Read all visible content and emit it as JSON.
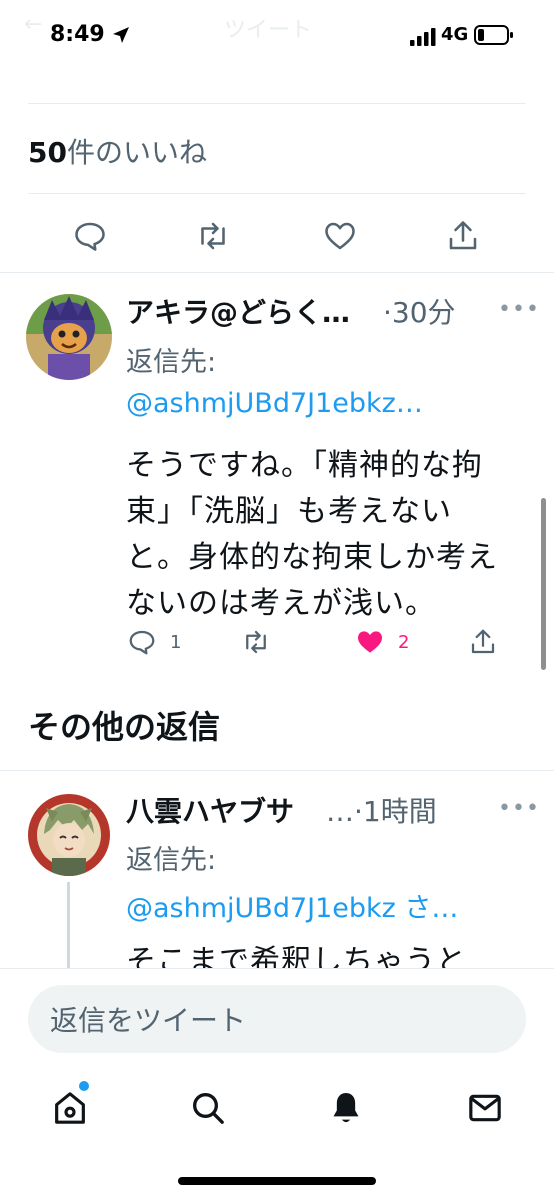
{
  "status_bar": {
    "time": "8:49",
    "network": "4G"
  },
  "header": {
    "ghost_title": "ツイート"
  },
  "likes": {
    "count": "50",
    "label": "件のいいね"
  },
  "reply1": {
    "name": "アキラ@どらく…",
    "time": "·30分",
    "more": "•••",
    "reply_to_label": "返信先:",
    "mention": "@ashmjUBd7J1ebkz…",
    "body": [
      "そうですね。「精神的な拘",
      "束」「洗脳」も考えない",
      "と。身体的な拘束しか考え",
      "ないのは考えが浅い。"
    ],
    "reply_count": "1",
    "like_count": "2"
  },
  "section": {
    "other_replies": "その他の返信"
  },
  "reply2": {
    "name": "八雲ハヤブサ",
    "time": "…·1時間",
    "more": "•••",
    "reply_to_label": "返信先:",
    "mention": "@ashmjUBd7J1ebkz さ…",
    "body": [
      "そこまで希釈しちゃうと"
    ]
  },
  "compose": {
    "placeholder": "返信をツイート"
  },
  "tabs": {
    "items": [
      "home-icon",
      "search-icon",
      "bell-icon",
      "mail-icon"
    ]
  },
  "colors": {
    "accent": "#1d9bf0",
    "like": "#f91880",
    "text": "#0f1419",
    "muted": "#536471"
  }
}
